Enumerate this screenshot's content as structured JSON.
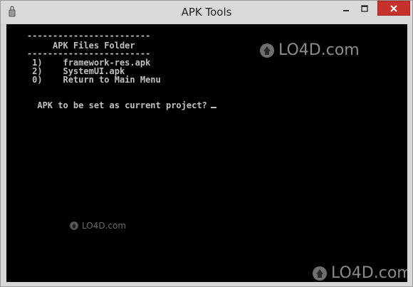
{
  "window": {
    "title": "APK Tools"
  },
  "console": {
    "lines": [
      "    ------------------------",
      "         APK Files Folder",
      "    ------------------------",
      "     1)    framework-res.apk",
      "     2)    SystemUI.apk",
      "     0)    Return to Main Menu",
      "APK to be set as current project?"
    ]
  },
  "watermark": {
    "text": "LO4D.com"
  },
  "icons": {
    "app": "app-icon",
    "minimize": "minimize-icon",
    "maximize": "maximize-icon",
    "close": "close-icon",
    "watermark_logo": "lo4d-logo-icon"
  },
  "colors": {
    "console_bg": "#000000",
    "console_fg": "#c0c0c0",
    "close_button": "#c7312b",
    "titlebar": "#d9d9d9"
  }
}
